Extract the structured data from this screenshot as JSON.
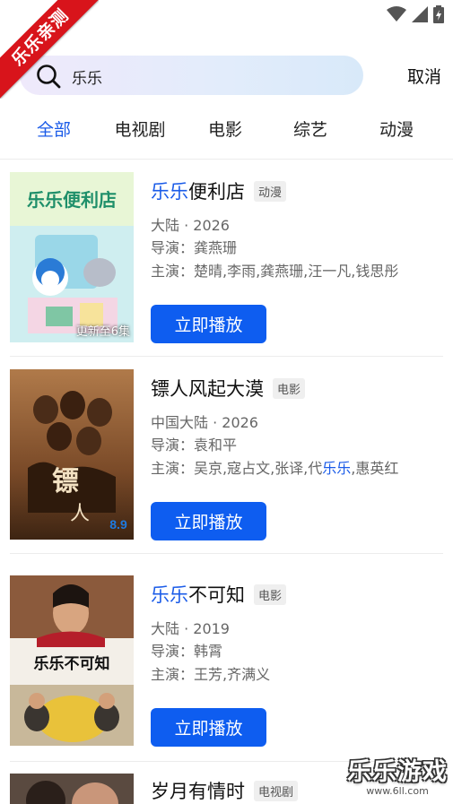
{
  "ribbon": {
    "text": "乐乐亲测"
  },
  "search": {
    "query": "乐乐",
    "cancel_label": "取消"
  },
  "tabs": [
    {
      "label": "全部",
      "active": true
    },
    {
      "label": "电视剧",
      "active": false
    },
    {
      "label": "电影",
      "active": false
    },
    {
      "label": "综艺",
      "active": false
    },
    {
      "label": "动漫",
      "active": false
    }
  ],
  "results": [
    {
      "title_highlight": "乐乐",
      "title_rest": "便利店",
      "badge": "动漫",
      "region_year": "大陆 · 2026",
      "director": "导演：龚燕珊",
      "cast": "主演：楚晴,李雨,龚燕珊,汪一凡,钱思彤",
      "poster_caption": "更新至6集",
      "play_label": "立即播放"
    },
    {
      "title_rest": "镖人风起大漠",
      "badge": "电影",
      "region_year": "中国大陆 · 2026",
      "director": "导演：袁和平",
      "cast_before": "主演：吴京,寇占文,张译,代",
      "cast_highlight": "乐乐",
      "cast_after": ",惠英红",
      "play_label": "立即播放"
    },
    {
      "title_highlight": "乐乐",
      "title_rest": "不可知",
      "badge": "电影",
      "region_year": "大陆 · 2019",
      "director": "导演：韩霄",
      "cast": "主演：王芳,齐满义",
      "play_label": "立即播放"
    },
    {
      "title_rest": "岁月有情时",
      "badge": "电视剧"
    }
  ],
  "watermark": {
    "logo": "乐乐游戏",
    "url": "www.6ll.com"
  },
  "colors": {
    "accent": "#1a5be8",
    "button": "#0e5df0",
    "ribbon": "#d8141b"
  }
}
